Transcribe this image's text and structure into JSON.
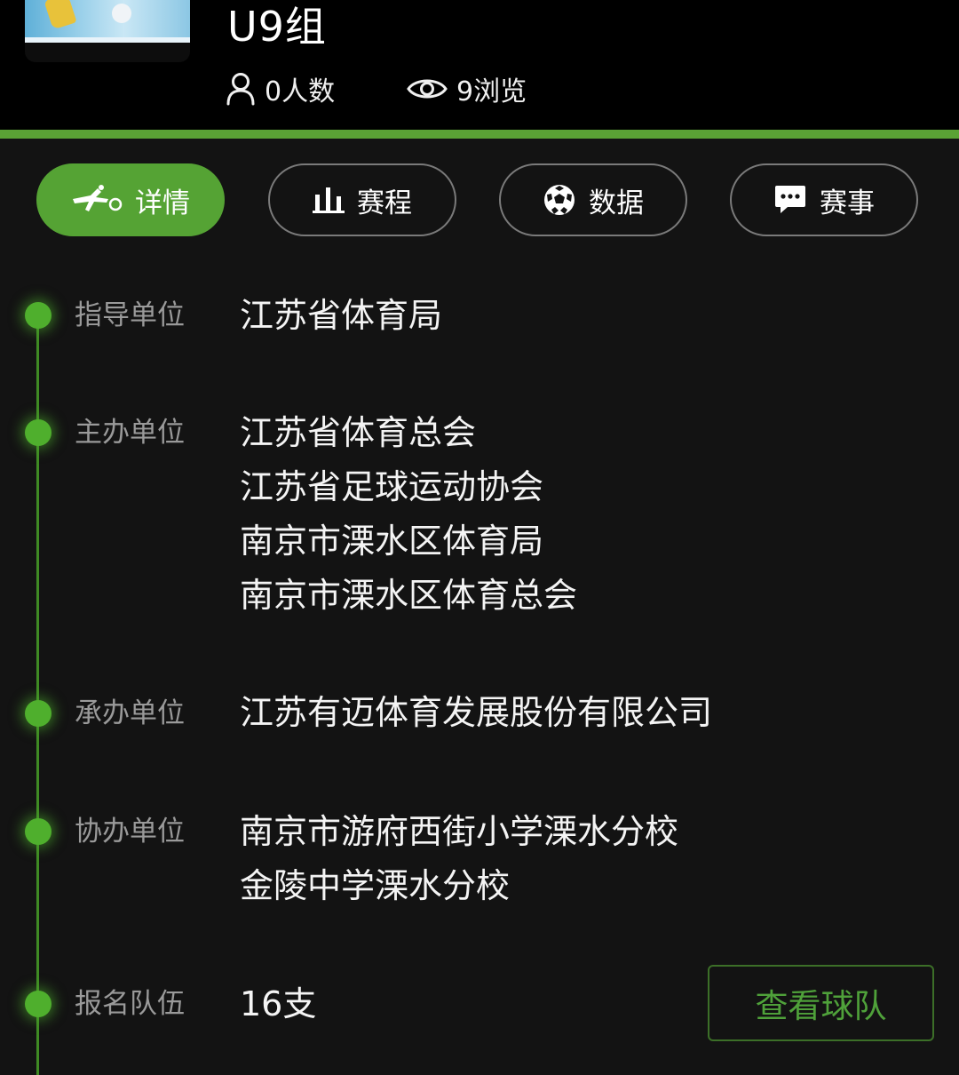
{
  "header": {
    "title": "U9组",
    "people_count": "0人数",
    "views": "9浏览"
  },
  "tabs": [
    {
      "label": "详情",
      "icon": "kick-icon",
      "active": true
    },
    {
      "label": "赛程",
      "icon": "bar-chart-icon",
      "active": false
    },
    {
      "label": "数据",
      "icon": "soccer-ball-icon",
      "active": false
    },
    {
      "label": "赛事",
      "icon": "chat-bubble-icon",
      "active": false
    }
  ],
  "details": [
    {
      "label": "指导单位",
      "values": [
        "江苏省体育局"
      ]
    },
    {
      "label": "主办单位",
      "values": [
        "江苏省体育总会",
        "江苏省足球运动协会",
        "南京市溧水区体育局",
        "南京市溧水区体育总会"
      ]
    },
    {
      "label": "承办单位",
      "values": [
        "江苏有迈体育发展股份有限公司"
      ]
    },
    {
      "label": "协办单位",
      "values": [
        "南京市游府西街小学溧水分校",
        "金陵中学溧水分校"
      ]
    },
    {
      "label": "报名队伍",
      "values": [
        "16支"
      ]
    }
  ],
  "view_teams_button": "查看球队",
  "colors": {
    "accent_green": "#55a334",
    "background": "#131313",
    "header_bg": "#000000"
  }
}
